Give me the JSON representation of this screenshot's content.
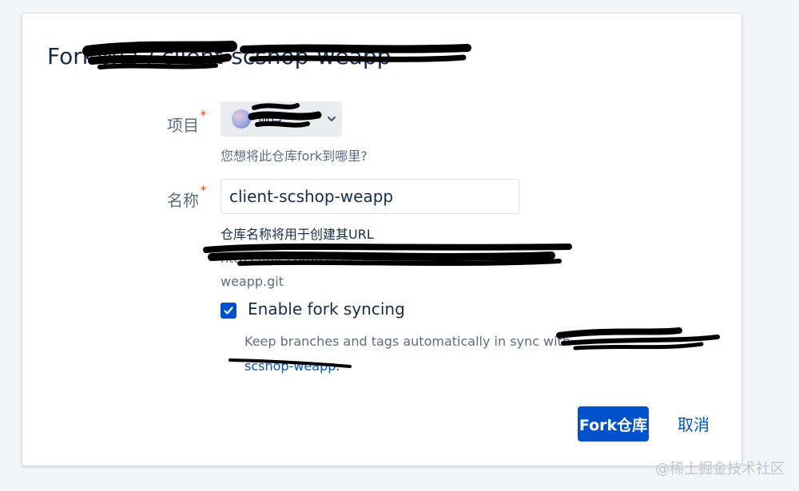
{
  "dialog": {
    "title": "Fork项目 / client-scshop-weapp",
    "project": {
      "label": "项目",
      "required_mark": "*",
      "selected": "项目",
      "help": "您想将此仓库fork到哪里?"
    },
    "name": {
      "label": "名称",
      "required_mark": "*",
      "value": "client-scshop-weapp",
      "help": "仓库名称将用于创建其URL",
      "url_line1": "https://git.com/client-scshop-",
      "url_line2": "weapp.git"
    },
    "sync": {
      "checked": true,
      "label": "Enable fork syncing",
      "desc_prefix": "Keep branches and tags automatically in sync with",
      "desc_link": "scshop-weapp."
    },
    "actions": {
      "fork": "Fork仓库",
      "cancel": "取消"
    }
  },
  "watermark": "@稀土掘金技术社区",
  "colors": {
    "primary": "#0052cc",
    "background": "#f4f5f7",
    "required": "#de350b",
    "muted_text": "#5e6c84"
  }
}
